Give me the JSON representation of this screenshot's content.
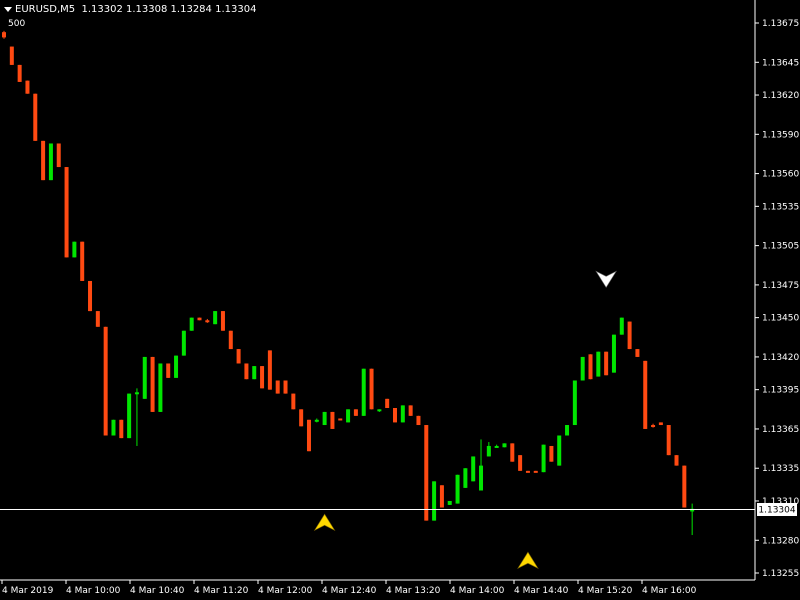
{
  "window": {
    "symbol_title": "EURUSD,M5",
    "ohlc": "1.13302 1.13308 1.13284 1.13304",
    "sub_label": "500"
  },
  "colors": {
    "background": "#000000",
    "bull": "#00E600",
    "bear": "#FF4A12",
    "axis": "#FFFFFF",
    "price_line": "#FFFFFF",
    "arrow_up": "#FFD800",
    "arrow_down": "#FFFFFF"
  },
  "chart_data": {
    "type": "candlestick",
    "symbol": "EURUSD",
    "timeframe": "M5",
    "y_ticks": [
      "1.13675",
      "1.13645",
      "1.13620",
      "1.13590",
      "1.13560",
      "1.13535",
      "1.13505",
      "1.13475",
      "1.13450",
      "1.13420",
      "1.13395",
      "1.13365",
      "1.13335",
      "1.13310",
      "1.13280",
      "1.13255"
    ],
    "x_ticks": [
      "4 Mar 2019",
      "4 Mar 10:00",
      "4 Mar 10:40",
      "4 Mar 11:20",
      "4 Mar 12:00",
      "4 Mar 12:40",
      "4 Mar 13:20",
      "4 Mar 14:00",
      "4 Mar 14:40",
      "4 Mar 15:20",
      "4 Mar 16:00"
    ],
    "ylim": [
      1.1325,
      1.13698
    ],
    "current_price": "1.13304",
    "candles": [
      {
        "o": 1.13668,
        "c": 1.13664,
        "h": 1.13669,
        "l": 1.13663
      },
      {
        "o": 1.13657,
        "c": 1.13643,
        "h": 1.13657,
        "l": 1.13643
      },
      {
        "o": 1.13643,
        "c": 1.1363,
        "h": 1.13643,
        "l": 1.1363
      },
      {
        "o": 1.13631,
        "c": 1.13621,
        "h": 1.13631,
        "l": 1.13621
      },
      {
        "o": 1.13621,
        "c": 1.13585,
        "h": 1.13621,
        "l": 1.13585
      },
      {
        "o": 1.13585,
        "c": 1.13555,
        "h": 1.13585,
        "l": 1.13555
      },
      {
        "o": 1.13555,
        "c": 1.13583,
        "h": 1.13583,
        "l": 1.13555
      },
      {
        "o": 1.13583,
        "c": 1.13565,
        "h": 1.13583,
        "l": 1.13565
      },
      {
        "o": 1.13565,
        "c": 1.13496,
        "h": 1.13565,
        "l": 1.13496
      },
      {
        "o": 1.13496,
        "c": 1.13508,
        "h": 1.13508,
        "l": 1.13496
      },
      {
        "o": 1.13508,
        "c": 1.13478,
        "h": 1.13508,
        "l": 1.13478
      },
      {
        "o": 1.13478,
        "c": 1.13455,
        "h": 1.13478,
        "l": 1.13455
      },
      {
        "o": 1.13455,
        "c": 1.13443,
        "h": 1.13455,
        "l": 1.13443
      },
      {
        "o": 1.13443,
        "c": 1.1336,
        "h": 1.13443,
        "l": 1.1336
      },
      {
        "o": 1.1336,
        "c": 1.13372,
        "h": 1.13372,
        "l": 1.1336
      },
      {
        "o": 1.13372,
        "c": 1.13358,
        "h": 1.13372,
        "l": 1.13358
      },
      {
        "o": 1.13358,
        "c": 1.13392,
        "h": 1.13392,
        "l": 1.13358
      },
      {
        "o": 1.13392,
        "c": 1.13393,
        "h": 1.13396,
        "l": 1.13352
      },
      {
        "o": 1.13388,
        "c": 1.1342,
        "h": 1.1342,
        "l": 1.13388
      },
      {
        "o": 1.1342,
        "c": 1.13378,
        "h": 1.1342,
        "l": 1.13378
      },
      {
        "o": 1.13378,
        "c": 1.13415,
        "h": 1.13415,
        "l": 1.13378
      },
      {
        "o": 1.13415,
        "c": 1.13404,
        "h": 1.13415,
        "l": 1.13404
      },
      {
        "o": 1.13404,
        "c": 1.13421,
        "h": 1.13421,
        "l": 1.13404
      },
      {
        "o": 1.13421,
        "c": 1.1344,
        "h": 1.1344,
        "l": 1.13421
      },
      {
        "o": 1.1344,
        "c": 1.1345,
        "h": 1.1345,
        "l": 1.1344
      },
      {
        "o": 1.1345,
        "c": 1.13448,
        "h": 1.1345,
        "l": 1.13448
      },
      {
        "o": 1.13448,
        "c": 1.13447,
        "h": 1.13449,
        "l": 1.13446
      },
      {
        "o": 1.13445,
        "c": 1.13455,
        "h": 1.13455,
        "l": 1.13445
      },
      {
        "o": 1.13455,
        "c": 1.1344,
        "h": 1.13455,
        "l": 1.1344
      },
      {
        "o": 1.1344,
        "c": 1.13426,
        "h": 1.1344,
        "l": 1.13426
      },
      {
        "o": 1.13426,
        "c": 1.13415,
        "h": 1.13426,
        "l": 1.13415
      },
      {
        "o": 1.13415,
        "c": 1.13403,
        "h": 1.13415,
        "l": 1.13403
      },
      {
        "o": 1.13403,
        "c": 1.13413,
        "h": 1.13413,
        "l": 1.13403
      },
      {
        "o": 1.13413,
        "c": 1.13396,
        "h": 1.13413,
        "l": 1.13396
      },
      {
        "o": 1.13425,
        "c": 1.13395,
        "h": 1.13425,
        "l": 1.13395
      },
      {
        "o": 1.13402,
        "c": 1.13392,
        "h": 1.13402,
        "l": 1.13392
      },
      {
        "o": 1.13402,
        "c": 1.13392,
        "h": 1.13402,
        "l": 1.13392
      },
      {
        "o": 1.13392,
        "c": 1.1338,
        "h": 1.13392,
        "l": 1.1338
      },
      {
        "o": 1.1338,
        "c": 1.13367,
        "h": 1.1338,
        "l": 1.13367
      },
      {
        "o": 1.13372,
        "c": 1.13348,
        "h": 1.13372,
        "l": 1.13348
      },
      {
        "o": 1.13371,
        "c": 1.13372,
        "h": 1.13373,
        "l": 1.1337
      },
      {
        "o": 1.13368,
        "c": 1.13378,
        "h": 1.13378,
        "l": 1.13368
      },
      {
        "o": 1.13378,
        "c": 1.13365,
        "h": 1.13378,
        "l": 1.13365
      },
      {
        "o": 1.13373,
        "c": 1.13372,
        "h": 1.13373,
        "l": 1.13372
      },
      {
        "o": 1.1337,
        "c": 1.1338,
        "h": 1.1338,
        "l": 1.1337
      },
      {
        "o": 1.1338,
        "c": 1.13375,
        "h": 1.1338,
        "l": 1.13375
      },
      {
        "o": 1.13375,
        "c": 1.13411,
        "h": 1.13411,
        "l": 1.13375
      },
      {
        "o": 1.13411,
        "c": 1.1338,
        "h": 1.13411,
        "l": 1.1338
      },
      {
        "o": 1.1338,
        "c": 1.1338,
        "h": 1.1338,
        "l": 1.13378
      },
      {
        "o": 1.13388,
        "c": 1.13381,
        "h": 1.13388,
        "l": 1.13381
      },
      {
        "o": 1.13381,
        "c": 1.1337,
        "h": 1.13381,
        "l": 1.1337
      },
      {
        "o": 1.1337,
        "c": 1.13383,
        "h": 1.13383,
        "l": 1.1337
      },
      {
        "o": 1.13383,
        "c": 1.13375,
        "h": 1.13383,
        "l": 1.13375
      },
      {
        "o": 1.13375,
        "c": 1.13368,
        "h": 1.13375,
        "l": 1.13368
      },
      {
        "o": 1.13368,
        "c": 1.13295,
        "h": 1.13368,
        "l": 1.13295
      },
      {
        "o": 1.13295,
        "c": 1.13325,
        "h": 1.13325,
        "l": 1.13295
      },
      {
        "o": 1.13322,
        "c": 1.13305,
        "h": 1.13322,
        "l": 1.13305
      },
      {
        "o": 1.13307,
        "c": 1.1331,
        "h": 1.1331,
        "l": 1.13307
      },
      {
        "o": 1.13308,
        "c": 1.1333,
        "h": 1.1333,
        "l": 1.13308
      },
      {
        "o": 1.1332,
        "c": 1.13335,
        "h": 1.13335,
        "l": 1.1332
      },
      {
        "o": 1.13325,
        "c": 1.13344,
        "h": 1.13344,
        "l": 1.13325
      },
      {
        "o": 1.13318,
        "c": 1.13337,
        "h": 1.13357,
        "l": 1.13318
      },
      {
        "o": 1.13344,
        "c": 1.13352,
        "h": 1.13355,
        "l": 1.13344
      },
      {
        "o": 1.13352,
        "c": 1.13352,
        "h": 1.13353,
        "l": 1.13351
      },
      {
        "o": 1.13351,
        "c": 1.13354,
        "h": 1.13354,
        "l": 1.13351
      },
      {
        "o": 1.13354,
        "c": 1.1334,
        "h": 1.13354,
        "l": 1.1334
      },
      {
        "o": 1.13345,
        "c": 1.13333,
        "h": 1.13345,
        "l": 1.13333
      },
      {
        "o": 1.13333,
        "c": 1.13332,
        "h": 1.13333,
        "l": 1.13332
      },
      {
        "o": 1.13333,
        "c": 1.13332,
        "h": 1.13333,
        "l": 1.13332
      },
      {
        "o": 1.13332,
        "c": 1.13353,
        "h": 1.13353,
        "l": 1.13332
      },
      {
        "o": 1.13352,
        "c": 1.1334,
        "h": 1.13352,
        "l": 1.1334
      },
      {
        "o": 1.13337,
        "c": 1.1336,
        "h": 1.1336,
        "l": 1.13337
      },
      {
        "o": 1.1336,
        "c": 1.13368,
        "h": 1.13368,
        "l": 1.1336
      },
      {
        "o": 1.13368,
        "c": 1.13402,
        "h": 1.13402,
        "l": 1.13368
      },
      {
        "o": 1.13402,
        "c": 1.1342,
        "h": 1.1342,
        "l": 1.13402
      },
      {
        "o": 1.13422,
        "c": 1.13403,
        "h": 1.13422,
        "l": 1.13403
      },
      {
        "o": 1.13405,
        "c": 1.13424,
        "h": 1.13424,
        "l": 1.13405
      },
      {
        "o": 1.13424,
        "c": 1.13406,
        "h": 1.13424,
        "l": 1.13406
      },
      {
        "o": 1.13408,
        "c": 1.13437,
        "h": 1.13437,
        "l": 1.13408
      },
      {
        "o": 1.13437,
        "c": 1.1345,
        "h": 1.1345,
        "l": 1.13437
      },
      {
        "o": 1.13447,
        "c": 1.13426,
        "h": 1.13447,
        "l": 1.13426
      },
      {
        "o": 1.13426,
        "c": 1.1342,
        "h": 1.13426,
        "l": 1.1342
      },
      {
        "o": 1.13417,
        "c": 1.13365,
        "h": 1.13417,
        "l": 1.13365
      },
      {
        "o": 1.13368,
        "c": 1.13367,
        "h": 1.13369,
        "l": 1.13366
      },
      {
        "o": 1.1337,
        "c": 1.13368,
        "h": 1.1337,
        "l": 1.13368
      },
      {
        "o": 1.13368,
        "c": 1.13345,
        "h": 1.13368,
        "l": 1.13345
      },
      {
        "o": 1.13345,
        "c": 1.13337,
        "h": 1.13345,
        "l": 1.13337
      },
      {
        "o": 1.13337,
        "c": 1.13305,
        "h": 1.13337,
        "l": 1.13305
      },
      {
        "o": 1.13302,
        "c": 1.13304,
        "h": 1.13308,
        "l": 1.13284
      }
    ],
    "signals": [
      {
        "type": "up",
        "index": 41,
        "price": 1.13293
      },
      {
        "type": "up",
        "index": 67,
        "price": 1.13264
      },
      {
        "type": "down",
        "index": 77,
        "price": 1.1348
      }
    ]
  }
}
